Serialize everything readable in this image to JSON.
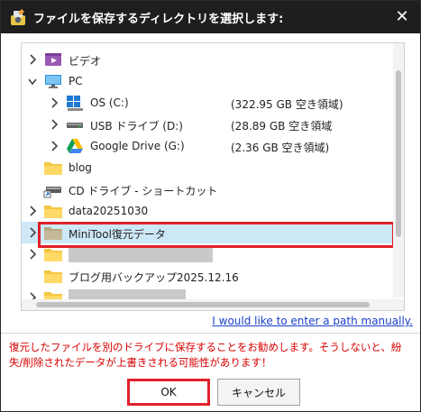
{
  "window": {
    "title": "ファイルを保存するディレクトリを選択します:",
    "close_glyph": "✕"
  },
  "tree": {
    "items": [
      {
        "label": "ビデオ",
        "size": "",
        "icon": "video-folder-icon",
        "expander": "collapsed"
      },
      {
        "label": "PC",
        "size": "",
        "icon": "monitor-icon",
        "expander": "expanded"
      },
      {
        "label": "OS (C:)",
        "size": "(322.95 GB 空き領域)",
        "icon": "windows-drive-icon",
        "expander": "collapsed"
      },
      {
        "label": "USB ドライブ (D:)",
        "size": "(28.89 GB 空き領域",
        "icon": "usb-drive-icon",
        "expander": "collapsed"
      },
      {
        "label": "Google Drive (G:)",
        "size": "(2.36 GB 空き領域)",
        "icon": "google-drive-icon",
        "expander": "collapsed"
      },
      {
        "label": "blog",
        "size": "",
        "icon": "folder-icon",
        "expander": "none"
      },
      {
        "label": "CD ドライブ - ショートカット",
        "size": "",
        "icon": "shortcut-drive-icon",
        "expander": "none"
      },
      {
        "label": "data20251030",
        "size": "",
        "icon": "folder-icon",
        "expander": "collapsed"
      },
      {
        "label": "MiniTool復元データ",
        "size": "",
        "icon": "folder-icon",
        "expander": "collapsed",
        "selected": true
      },
      {
        "label": "",
        "size": "",
        "icon": "folder-icon",
        "expander": "collapsed",
        "redacted": true
      },
      {
        "label": "ブログ用バックアップ2025.12.16",
        "size": "",
        "icon": "folder-icon",
        "expander": "none"
      },
      {
        "label": "",
        "size": "",
        "icon": "folder-icon",
        "expander": "collapsed",
        "redacted": true
      }
    ]
  },
  "manual_path_link": "I would like to enter a path manually.",
  "warning_text": "復元したファイルを別のドライブに保存することをお勧めします。そうしないと、紛失/削除されたデータが上書きされる可能性があります！",
  "buttons": {
    "ok": "OK",
    "cancel": "キャンセル"
  },
  "colors": {
    "titlebar": "#1e1e1e",
    "selection": "#cde8f7",
    "highlight": "#e0202a",
    "link": "#1a3fcc",
    "warning": "#d80000"
  }
}
